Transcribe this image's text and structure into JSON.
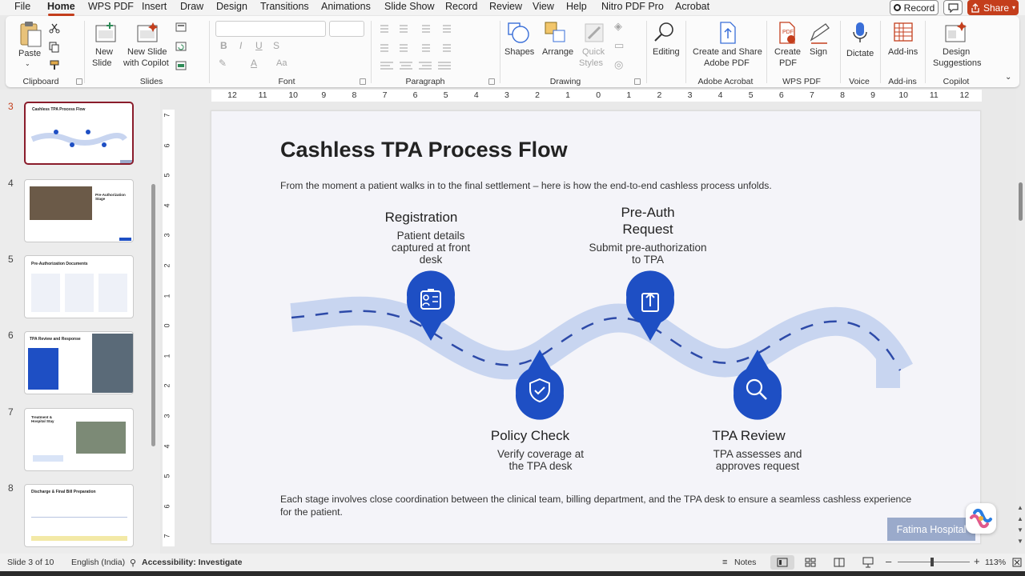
{
  "menu": {
    "tabs": [
      "File",
      "Home",
      "WPS PDF",
      "Insert",
      "Draw",
      "Design",
      "Transitions",
      "Animations",
      "Slide Show",
      "Record",
      "Review",
      "View",
      "Help",
      "Nitro PDF Pro",
      "Acrobat"
    ],
    "active_tab": "Home",
    "record_label": "Record",
    "share_label": "Share"
  },
  "ribbon": {
    "clipboard": {
      "group": "Clipboard",
      "paste": "Paste"
    },
    "slides": {
      "group": "Slides",
      "new_slide_1": "New",
      "new_slide_2": "Slide",
      "copilot_1": "New Slide",
      "copilot_2": "with Copilot"
    },
    "font": {
      "group": "Font"
    },
    "paragraph": {
      "group": "Paragraph"
    },
    "drawing": {
      "group": "Drawing",
      "shapes": "Shapes",
      "arrange": "Arrange",
      "quick_1": "Quick",
      "quick_2": "Styles"
    },
    "editing": {
      "label": "Editing"
    },
    "acrobat": {
      "group": "Adobe Acrobat",
      "btn_1": "Create and Share",
      "btn_2": "Adobe PDF"
    },
    "wpspdf": {
      "group": "WPS PDF",
      "create_1": "Create",
      "create_2": "PDF",
      "sign": "Sign"
    },
    "voice": {
      "group": "Voice",
      "dictate": "Dictate"
    },
    "addins": {
      "group": "Add-ins",
      "label": "Add-ins"
    },
    "copilot": {
      "group": "Copilot",
      "design_1": "Design",
      "design_2": "Suggestions"
    }
  },
  "thumbnails": [
    {
      "num": "3",
      "title": "Cashless TPA Process Flow"
    },
    {
      "num": "4",
      "title": "Pre-Authorization Stage"
    },
    {
      "num": "5",
      "title": "Pre-Authorization Documents"
    },
    {
      "num": "6",
      "title": "TPA Review and Response"
    },
    {
      "num": "7",
      "title": "Treatment & Hospital Stay"
    },
    {
      "num": "8",
      "title": "Discharge & Final Bill Preparation"
    }
  ],
  "ruler": {
    "h": [
      "12",
      "11",
      "10",
      "9",
      "8",
      "7",
      "6",
      "5",
      "4",
      "3",
      "2",
      "1",
      "0",
      "1",
      "2",
      "3",
      "4",
      "5",
      "6",
      "7",
      "8",
      "9",
      "10",
      "11",
      "12"
    ],
    "v": [
      "7",
      "6",
      "5",
      "4",
      "3",
      "2",
      "1",
      "0",
      "1",
      "2",
      "3",
      "4",
      "5",
      "6",
      "7"
    ]
  },
  "slide": {
    "title": "Cashless TPA Process Flow",
    "subtitle": "From the moment a patient walks in to the final settlement – here is how the end-to-end cashless process unfolds.",
    "stages": [
      {
        "title": "Registration",
        "desc": "Patient details captured at front desk",
        "icon": "id-card-icon"
      },
      {
        "title": "Policy Check",
        "desc": "Verify coverage at the TPA desk",
        "icon": "shield-check-icon"
      },
      {
        "title": "Pre-Auth Request",
        "desc": "Submit pre-authorization to TPA",
        "icon": "upload-document-icon"
      },
      {
        "title": "TPA Review",
        "desc": "TPA assesses and approves request",
        "icon": "magnifier-icon"
      }
    ],
    "footer": "Each stage involves close coordination between the clinical team, billing department, and the TPA desk to ensure a seamless cashless experience for the patient.",
    "badge": "Fatima Hospital",
    "colors": {
      "accent": "#1e4fc4",
      "road": "#c8d5f0",
      "road_dash": "#2d4aa8"
    }
  },
  "status": {
    "slide": "Slide 3 of 10",
    "language": "English (India)",
    "accessibility": "Accessibility: Investigate",
    "notes": "Notes",
    "zoom": "113%"
  }
}
